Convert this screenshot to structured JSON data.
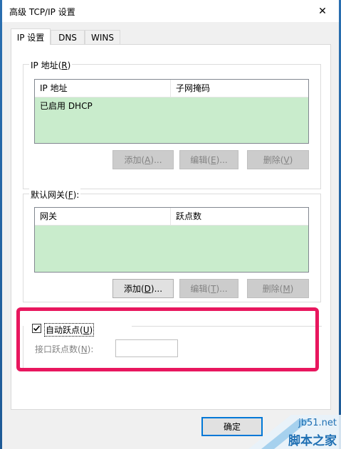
{
  "window": {
    "title": "高级 TCP/IP 设置",
    "close_glyph": "✕"
  },
  "tabs": [
    {
      "label": "IP 设置",
      "active": true
    },
    {
      "label": "DNS",
      "active": false
    },
    {
      "label": "WINS",
      "active": false
    }
  ],
  "ip_group": {
    "legend_text": "IP 地址(",
    "legend_key": "R",
    "legend_end": ")",
    "columns": [
      "IP 地址",
      "子网掩码"
    ],
    "rows": [
      [
        "已启用 DHCP",
        ""
      ]
    ],
    "buttons": [
      {
        "text": "添加(",
        "key": "A",
        "end": ")...",
        "disabled": true
      },
      {
        "text": "编辑(",
        "key": "E",
        "end": ")...",
        "disabled": true
      },
      {
        "text": "删除(",
        "key": "V",
        "end": ")",
        "disabled": true
      }
    ]
  },
  "gateway_group": {
    "legend_text": "默认网关(",
    "legend_key": "F",
    "legend_end": "):",
    "columns": [
      "网关",
      "跃点数"
    ],
    "rows": [],
    "buttons": [
      {
        "text": "添加(",
        "key": "D",
        "end": ")...",
        "disabled": false
      },
      {
        "text": "编辑(",
        "key": "T",
        "end": ")...",
        "disabled": true
      },
      {
        "text": "删除(",
        "key": "M",
        "end": ")",
        "disabled": true
      }
    ]
  },
  "metric": {
    "checkbox_text": "自动跃点(",
    "checkbox_key": "U",
    "checkbox_end": ")",
    "checked": true,
    "field_label_text": "接口跃点数(",
    "field_label_key": "N",
    "field_label_end": "):",
    "field_value": ""
  },
  "footer": {
    "ok_label": "确定"
  },
  "watermark": {
    "brand": "脚本之家",
    "site": "jb51.net"
  },
  "colors": {
    "list_bg": "#c9eccc",
    "highlight_border": "#e8175e",
    "primary_border": "#0078d7"
  }
}
